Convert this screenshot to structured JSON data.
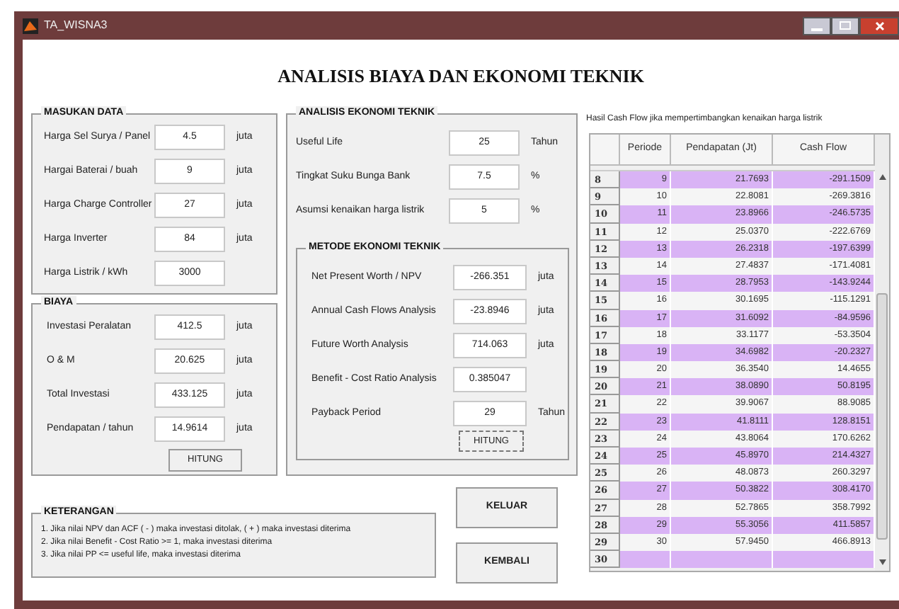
{
  "window": {
    "title": "TA_WISNA3"
  },
  "heading": "ANALISIS BIAYA DAN EKONOMI TEKNIK",
  "masukan_data": {
    "title": "MASUKAN DATA",
    "fields": [
      {
        "label": "Harga Sel Surya / Panel",
        "value": "4.5",
        "unit": "juta"
      },
      {
        "label": "Hargai Baterai / buah",
        "value": "9",
        "unit": "juta"
      },
      {
        "label": "Harga Charge Controller",
        "value": "27",
        "unit": "juta"
      },
      {
        "label": "Harga Inverter",
        "value": "84",
        "unit": "juta"
      },
      {
        "label": "Harga Listrik / kWh",
        "value": "3000"
      }
    ]
  },
  "biaya": {
    "title": "BIAYA",
    "fields": [
      {
        "label": "Investasi Peralatan",
        "value": "412.5",
        "unit": "juta"
      },
      {
        "label": "O & M",
        "value": "20.625",
        "unit": "juta"
      },
      {
        "label": "Total Investasi",
        "value": "433.125",
        "unit": "juta"
      },
      {
        "label": "Pendapatan / tahun",
        "value": "14.9614",
        "unit": "juta"
      }
    ],
    "button": "HITUNG"
  },
  "analisis": {
    "title": "ANALISIS EKONOMI TEKNIK",
    "fields": [
      {
        "label": "Useful Life",
        "value": "25",
        "unit": "Tahun"
      },
      {
        "label": "Tingkat Suku Bunga Bank",
        "value": "7.5",
        "unit": "%"
      },
      {
        "label": "Asumsi kenaikan harga listrik",
        "value": "5",
        "unit": "%"
      }
    ],
    "metode": {
      "title": "METODE EKONOMI TEKNIK",
      "fields": [
        {
          "label": "Net Present Worth / NPV",
          "value": "-266.351",
          "unit": "juta"
        },
        {
          "label": "Annual Cash Flows Analysis",
          "value": "-23.8946",
          "unit": "juta"
        },
        {
          "label": "Future Worth Analysis",
          "value": "714.063",
          "unit": "juta"
        },
        {
          "label": "Benefit - Cost Ratio Analysis",
          "value": "0.385047"
        },
        {
          "label": "Payback Period",
          "value": "29",
          "unit": "Tahun"
        }
      ],
      "button": "HITUNG"
    }
  },
  "cash_flow": {
    "caption": "Hasil Cash Flow jika mempertimbangkan kenaikan harga listrik",
    "columns": [
      "Periode",
      "Pendapatan (Jt)",
      "Cash Flow"
    ],
    "rows": [
      {
        "header": "8",
        "cells": [
          "9",
          "21.7693",
          "-291.1509"
        ],
        "highlighted": true
      },
      {
        "header": "9",
        "cells": [
          "10",
          "22.8081",
          "-269.3816"
        ],
        "highlighted": false
      },
      {
        "header": "10",
        "cells": [
          "11",
          "23.8966",
          "-246.5735"
        ],
        "highlighted": true
      },
      {
        "header": "11",
        "cells": [
          "12",
          "25.0370",
          "-222.6769"
        ],
        "highlighted": false
      },
      {
        "header": "12",
        "cells": [
          "13",
          "26.2318",
          "-197.6399"
        ],
        "highlighted": true
      },
      {
        "header": "13",
        "cells": [
          "14",
          "27.4837",
          "-171.4081"
        ],
        "highlighted": false
      },
      {
        "header": "14",
        "cells": [
          "15",
          "28.7953",
          "-143.9244"
        ],
        "highlighted": true
      },
      {
        "header": "15",
        "cells": [
          "16",
          "30.1695",
          "-115.1291"
        ],
        "highlighted": false
      },
      {
        "header": "16",
        "cells": [
          "17",
          "31.6092",
          "-84.9596"
        ],
        "highlighted": true
      },
      {
        "header": "17",
        "cells": [
          "18",
          "33.1177",
          "-53.3504"
        ],
        "highlighted": false
      },
      {
        "header": "18",
        "cells": [
          "19",
          "34.6982",
          "-20.2327"
        ],
        "highlighted": true
      },
      {
        "header": "19",
        "cells": [
          "20",
          "36.3540",
          "14.4655"
        ],
        "highlighted": false
      },
      {
        "header": "20",
        "cells": [
          "21",
          "38.0890",
          "50.8195"
        ],
        "highlighted": true
      },
      {
        "header": "21",
        "cells": [
          "22",
          "39.9067",
          "88.9085"
        ],
        "highlighted": false
      },
      {
        "header": "22",
        "cells": [
          "23",
          "41.8111",
          "128.8151"
        ],
        "highlighted": true
      },
      {
        "header": "23",
        "cells": [
          "24",
          "43.8064",
          "170.6262"
        ],
        "highlighted": false
      },
      {
        "header": "24",
        "cells": [
          "25",
          "45.8970",
          "214.4327"
        ],
        "highlighted": true
      },
      {
        "header": "25",
        "cells": [
          "26",
          "48.0873",
          "260.3297"
        ],
        "highlighted": false
      },
      {
        "header": "26",
        "cells": [
          "27",
          "50.3822",
          "308.4170"
        ],
        "highlighted": true
      },
      {
        "header": "27",
        "cells": [
          "28",
          "52.7865",
          "358.7992"
        ],
        "highlighted": false
      },
      {
        "header": "28",
        "cells": [
          "29",
          "55.3056",
          "411.5857"
        ],
        "highlighted": true
      },
      {
        "header": "29",
        "cells": [
          "30",
          "57.9450",
          "466.8913"
        ],
        "highlighted": false
      },
      {
        "header": "30",
        "cells": [],
        "highlighted": true
      }
    ]
  },
  "keterangan": {
    "title": "KETERANGAN",
    "lines": [
      "1. Jika nilai NPV dan ACF ( - ) maka investasi ditolak, ( + ) maka investasi diterima",
      "2. Jika nilai Benefit - Cost Ratio >= 1, maka investasi diterima",
      "3. Jika nilai PP <= useful life, maka investasi diterima"
    ]
  },
  "buttons": [
    "KELUAR",
    "KEMBALI"
  ]
}
